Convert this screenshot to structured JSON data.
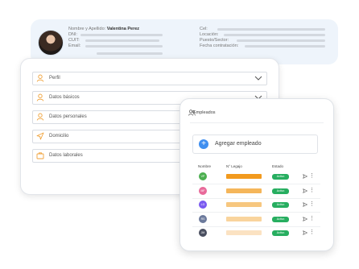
{
  "profile": {
    "name_label": "Nombre y Apellido:",
    "name_value": "Valentina Perez",
    "left_fields": [
      "DNI:",
      "CUIT:",
      "Email:"
    ],
    "right_fields": [
      "Cel:",
      "Locación:",
      "Puesto/Sector:",
      "Fecha contratación:"
    ]
  },
  "sections": [
    {
      "label": "Perfil",
      "icon": "user-icon"
    },
    {
      "label": "Datos básicos",
      "icon": "user-icon"
    },
    {
      "label": "Datos personales",
      "icon": "user-icon"
    },
    {
      "label": "Domicilio",
      "icon": "location-arrow-icon"
    },
    {
      "label": "Datos laborales",
      "icon": "briefcase-icon"
    }
  ],
  "employees": {
    "title": "Empleados",
    "add_label": "Agregar empleado",
    "columns": [
      "Nombre",
      "N° Legajo",
      "Estado"
    ],
    "rows": [
      {
        "initials": "VP",
        "avatar_color": "#4caf50",
        "bar_color": "#f29a1e",
        "status": "Activo"
      },
      {
        "initials": "MF",
        "avatar_color": "#e86a9a",
        "bar_color": "#f5b65a",
        "status": "Activo"
      },
      {
        "initials": "LG",
        "avatar_color": "#7a5af0",
        "bar_color": "#f7c77f",
        "status": "Activo"
      },
      {
        "initials": "RS",
        "avatar_color": "#6c7a9c",
        "bar_color": "#f9d49d",
        "status": "Activo"
      },
      {
        "initials": "JM",
        "avatar_color": "#4a4f60",
        "bar_color": "#fbe2c2",
        "status": "Activo"
      }
    ]
  },
  "colors": {
    "accent": "#3f8ff0",
    "icon_orange": "#f0a23a",
    "status_green": "#27ae60"
  }
}
